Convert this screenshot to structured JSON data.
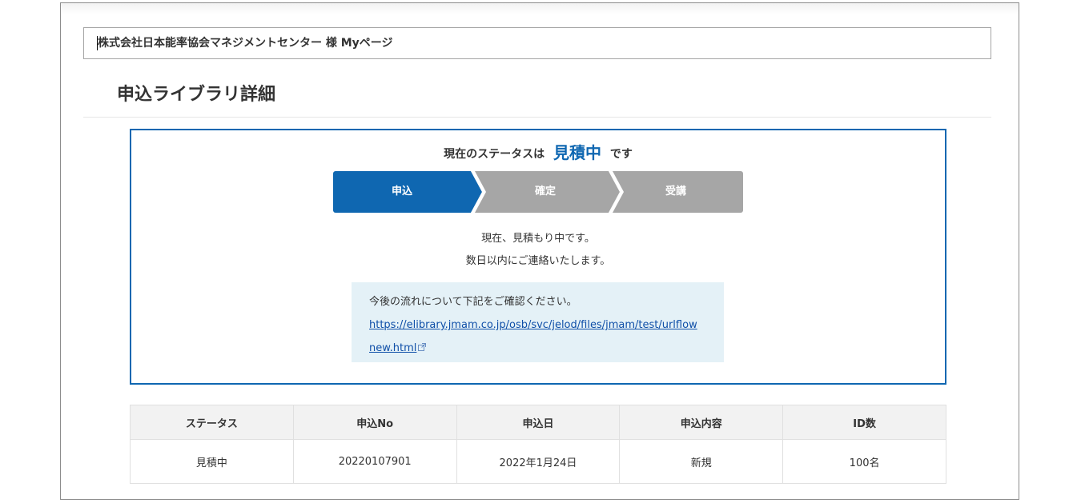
{
  "header": {
    "account_title": "株式会社日本能率協会マネジメントセンター 様 Myページ"
  },
  "page": {
    "title": "申込ライブラリ詳細"
  },
  "status": {
    "prefix": "現在のステータスは",
    "value": "見積中",
    "suffix": "です",
    "steps": [
      {
        "label": "申込",
        "active": true
      },
      {
        "label": "確定",
        "active": false
      },
      {
        "label": "受講",
        "active": false
      }
    ],
    "message_line1": "現在、見積もり中です。",
    "message_line2": "数日以内にご連絡いたします。"
  },
  "info": {
    "text": "今後の流れについて下記をご確認ください。",
    "link": "https://elibrary.jmam.co.jp/osb/svc/jelod/files/jmam/test/urlflownew.html",
    "link_icon": "external-link-icon"
  },
  "table": {
    "headers": [
      "ステータス",
      "申込No",
      "申込日",
      "申込内容",
      "ID数"
    ],
    "rows": [
      [
        "見積中",
        "20220107901",
        "2022年1月24日",
        "新規",
        "100名"
      ]
    ]
  },
  "colors": {
    "accent": "#0f67b1",
    "step_inactive": "#a6a6a6",
    "info_bg": "#e4f1f7",
    "link": "#0f4fa8"
  }
}
